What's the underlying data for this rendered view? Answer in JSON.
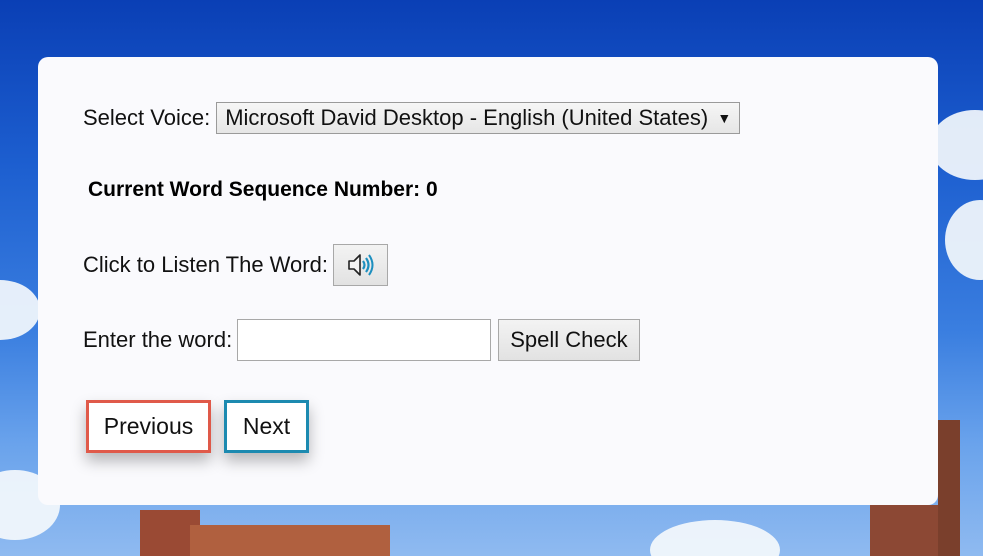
{
  "voice": {
    "label": "Select Voice:",
    "selected": "Microsoft David Desktop - English (United States)",
    "arrow": "▼"
  },
  "sequence": {
    "text": "Current Word Sequence Number: 0"
  },
  "listen": {
    "label": "Click to Listen The Word:",
    "icon": "speaker-icon"
  },
  "entry": {
    "label": "Enter the word:",
    "value": "",
    "spell_check_label": "Spell Check"
  },
  "navigation": {
    "previous_label": "Previous",
    "next_label": "Next",
    "previous_border_color": "#e05a4a",
    "next_border_color": "#1c8ab0"
  }
}
